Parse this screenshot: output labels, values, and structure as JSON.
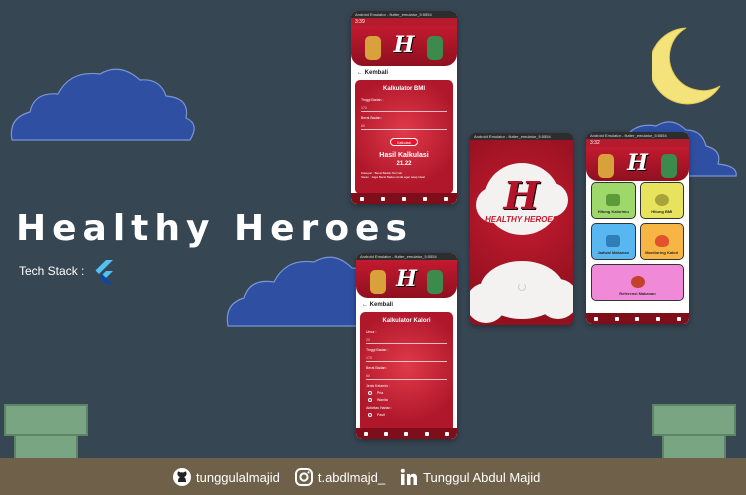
{
  "headline": {
    "title": "Healthy Heroes",
    "tech_stack_label": "Tech Stack :"
  },
  "footer": {
    "github": "tunggulalmajid",
    "instagram": "t.abdlmajd_",
    "linkedin": "Tunggul Abdul Majid"
  },
  "app": {
    "logo_text": "H",
    "brand_name": "HEALTHY HEROES",
    "emulator_title": "Android Emulator - flutter_emulator_5:5554",
    "back_label": "Kembali",
    "bmi_screen": {
      "status_time": "3:39",
      "card_title": "Kalkulator BMI",
      "height_label": "Tinggi Badan :",
      "height_value": "170",
      "weight_label": "Berat Badan :",
      "weight_value": "60",
      "calculate_button": "Kalkulasi",
      "result_title": "Hasil Kalkulasi",
      "result_value": "21.22",
      "category_label": "Kategori : Berat Badan Normal",
      "saran_label": "Saran : Jaga Berat Badan Anda agar tetap Ideal"
    },
    "calorie_screen": {
      "card_title": "Kalkulator Kalori",
      "age_label": "Umur :",
      "age_value": "20",
      "height_label": "Tinggi Badan :",
      "height_value": "170",
      "weight_label": "Berat Badan :",
      "weight_value": "60",
      "gender_label": "Jenis Kelamin :",
      "gender_options": [
        "Pria",
        "Wanita"
      ],
      "activity_label": "Aktivitas Harian :",
      "activity_value": "Pasif"
    },
    "menu_screen": {
      "status_time": "3:32",
      "items": [
        {
          "label": "Hitung Kalorimu",
          "color": "#9ed86a"
        },
        {
          "label": "Hitung BMI",
          "color": "#e8e35d"
        },
        {
          "label": "Jadwal Makanan",
          "color": "#58b6f0"
        },
        {
          "label": "Monitoring Kalori",
          "color": "#f7b544"
        },
        {
          "label": "Referensi Makanan",
          "color": "#f08ad8"
        }
      ]
    }
  },
  "colors": {
    "background": "#374653",
    "cloud": "#2f4ea0",
    "moon": "#f4e27a",
    "pipe": "#7aa583",
    "ground": "#6f6149",
    "brand_red": "#b51b2d"
  },
  "icons": [
    "github-icon",
    "instagram-icon",
    "linkedin-icon",
    "flutter-icon",
    "moon-icon",
    "back-arrow-icon"
  ]
}
